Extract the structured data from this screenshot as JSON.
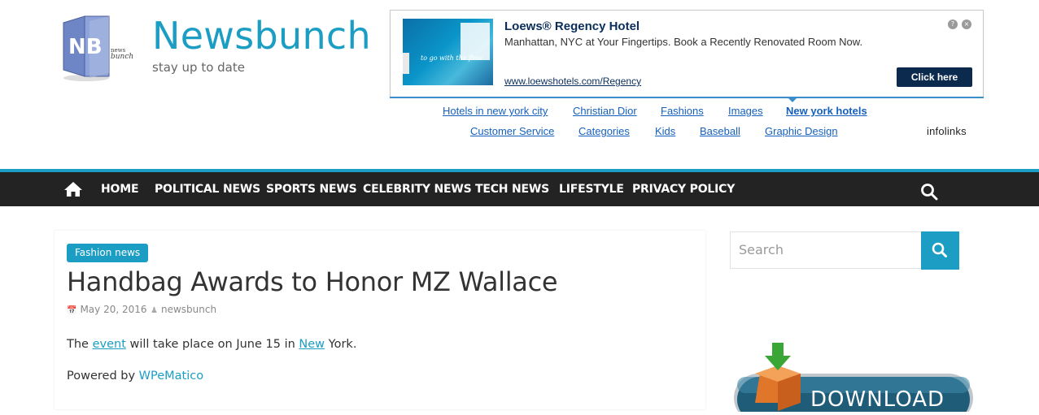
{
  "site": {
    "title": "Newsbunch",
    "tagline": "stay up to date",
    "logo_letters": "NB",
    "logo_small": "news",
    "logo_small2": "bunch"
  },
  "ad": {
    "title": "Loews® Regency Hotel",
    "description": "Manhattan, NYC at Your Fingertips. Book a Recently Renovated Room Now.",
    "url": "www.loewshotels.com/Regency",
    "cta": "Click here",
    "help": "?",
    "close": "×",
    "thumb_text": "to go with the flow"
  },
  "ad_links": {
    "row1": [
      "Hotels in new york city",
      "Christian Dior",
      "Fashions",
      "Images",
      "New york hotels"
    ],
    "row2": [
      "Customer Service",
      "Categories",
      "Kids",
      "Baseball",
      "Graphic Design"
    ],
    "brand": "infolinks"
  },
  "nav": {
    "items": [
      "HOME",
      "POLITICAL NEWS",
      "SPORTS NEWS",
      "CELEBRITY NEWS",
      "TECH NEWS",
      "LIFESTYLE",
      "PRIVACY POLICY"
    ]
  },
  "article": {
    "category": "Fashion news",
    "title": "Handbag Awards to Honor MZ Wallace",
    "date": "May 20, 2016",
    "author": "newsbunch",
    "body_pre": "The ",
    "body_link1": "event",
    "body_mid": " will take place on June 15 in ",
    "body_link2": "New",
    "body_post": " York.",
    "powered_pre": "Powered by ",
    "powered_link": "WPeMatico"
  },
  "sidebar": {
    "search_placeholder": "Search",
    "download_label": "DOWNLOAD"
  },
  "colors": {
    "accent": "#1b9dc4",
    "nav_bg": "#232323",
    "ad_navy": "#0b2a4e",
    "link_blue": "#1560bd"
  }
}
